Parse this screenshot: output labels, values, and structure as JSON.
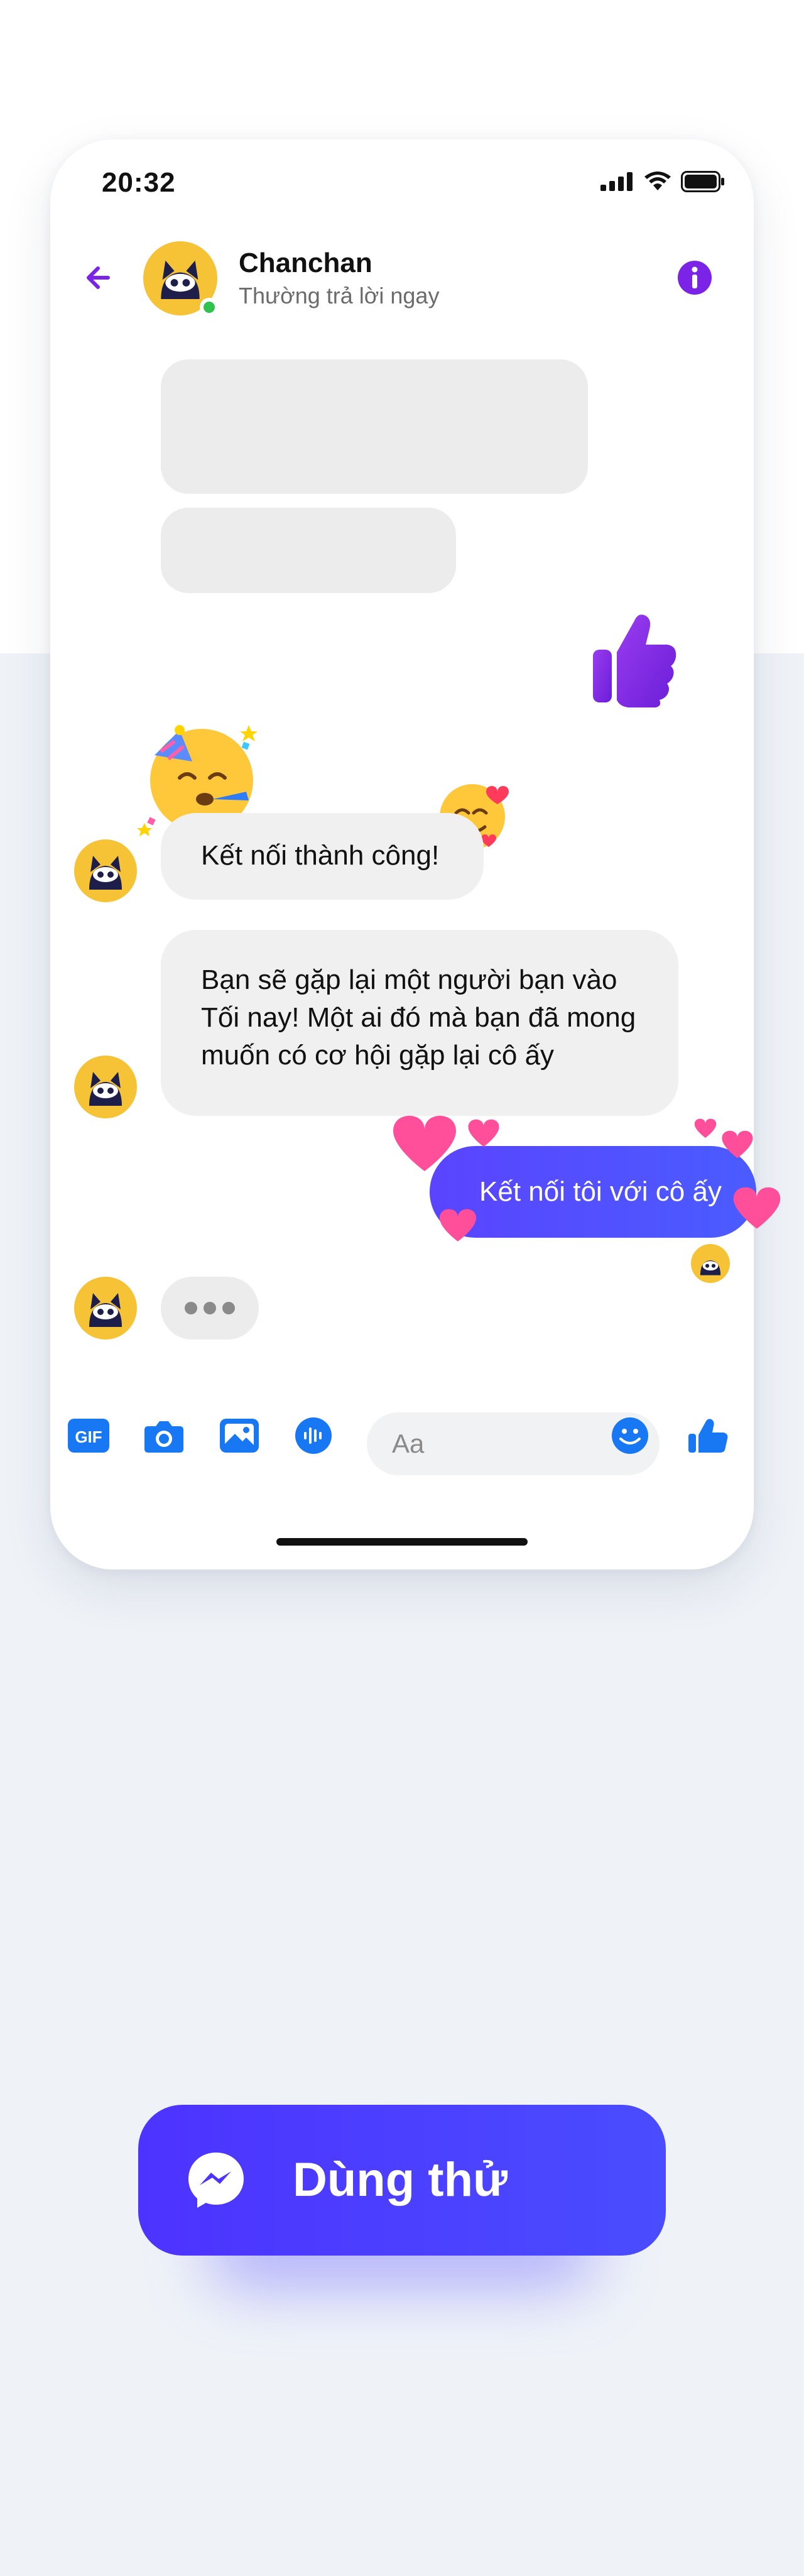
{
  "status_bar": {
    "time": "20:32",
    "icons": [
      "signal-icon",
      "wifi-icon",
      "battery-icon"
    ]
  },
  "header": {
    "back_icon": "arrow-left-icon",
    "name": "Chanchan",
    "status": "Thường trả lời ngay",
    "info_icon": "info-icon",
    "online": true
  },
  "messages": {
    "incoming_1": "Kết nối thành công!",
    "incoming_2_lines": [
      "Bạn sẽ gặp lại một người bạn vào",
      "Tối nay! Một ai đó mà bạn đã mong",
      "muốn có cơ hội gặp lại cô ấy"
    ],
    "outgoing_1": "Kết nối tôi với cô ấy",
    "typing_icon": "typing-dots-icon"
  },
  "composer": {
    "icons": [
      "gif-icon",
      "camera-icon",
      "image-icon",
      "voice-icon",
      "emoji-icon",
      "like-icon"
    ],
    "gif_label": "GIF",
    "placeholder": "Aa"
  },
  "cta": {
    "label": "Dùng thử",
    "icon": "messenger-icon"
  },
  "colors": {
    "accent_purple": "#7b24e8",
    "brand_blue": "#1877f2",
    "outgoing_bubble": "#4f4cff",
    "cta_button": "#4d33ff",
    "online": "#31c24d"
  }
}
